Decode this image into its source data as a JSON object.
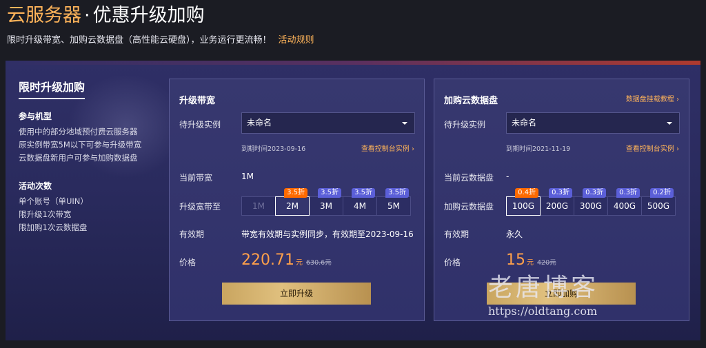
{
  "header": {
    "title_accent": "云服务器",
    "title_dot": "·",
    "title_rest": "优惠升级加购",
    "subtitle": "限时升级带宽、加购云数据盘（高性能云硬盘），业务运行更流畅！",
    "rules_link": "活动规则"
  },
  "sidebar": {
    "title": "限时升级加购",
    "mechanism": {
      "heading": "参与机型",
      "lines": [
        "使用中的部分地域预付费云服务器",
        "原实例带宽5M以下可参与升级带宽",
        "云数据盘新用户可参与加购数据盘"
      ]
    },
    "limits": {
      "heading": "活动次数",
      "lines": [
        "单个账号（单UIN）",
        "限升级1次带宽",
        "限加购1次云数据盘"
      ]
    }
  },
  "bandwidth_card": {
    "title": "升级带宽",
    "instance_label": "待升级实例",
    "instance_value": "未命名",
    "expire_text": "到期时间2023-09-16",
    "console_link": "查看控制台实例",
    "current_label": "当前带宽",
    "current_value": "1M",
    "upgrade_label": "升级宽带至",
    "options": [
      {
        "label": "1M",
        "badge": "",
        "state": "disabled"
      },
      {
        "label": "2M",
        "badge": "3.5折",
        "state": "selected"
      },
      {
        "label": "3M",
        "badge": "3.5折",
        "state": "normal"
      },
      {
        "label": "4M",
        "badge": "3.5折",
        "state": "normal"
      },
      {
        "label": "5M",
        "badge": "3.5折",
        "state": "normal"
      }
    ],
    "validity_label": "有效期",
    "validity_value": "带宽有效期与实例同步，有效期至2023-09-16",
    "price_label": "价格",
    "price": "220.71",
    "price_unit": "元",
    "old_price": "630.6元",
    "button": "立即升级"
  },
  "disk_card": {
    "title": "加购云数据盘",
    "help_link": "数据盘挂载教程",
    "instance_label": "待升级实例",
    "instance_value": "未命名",
    "expire_text": "到期时间2021-11-19",
    "console_link": "查看控制台实例",
    "current_label": "当前云数据盘",
    "current_value": "-",
    "upgrade_label": "加购云数据盘",
    "options": [
      {
        "label": "100G",
        "badge": "0.4折",
        "state": "selected"
      },
      {
        "label": "200G",
        "badge": "0.3折",
        "state": "normal"
      },
      {
        "label": "300G",
        "badge": "0.3折",
        "state": "normal"
      },
      {
        "label": "400G",
        "badge": "0.3折",
        "state": "normal"
      },
      {
        "label": "500G",
        "badge": "0.2折",
        "state": "normal"
      }
    ],
    "validity_label": "有效期",
    "validity_value": "永久",
    "price_label": "价格",
    "price": "15",
    "price_unit": "元",
    "old_price": "420元",
    "button": "立即加购"
  },
  "watermark": {
    "text_cn": "老唐博客",
    "url": "https://oldtang.com"
  },
  "colors": {
    "accent": "#ffb45a",
    "price": "#ffa04a",
    "badge_hot": "#ff6a00",
    "badge": "#5b5fd8",
    "button_gold": "#d8b670"
  }
}
